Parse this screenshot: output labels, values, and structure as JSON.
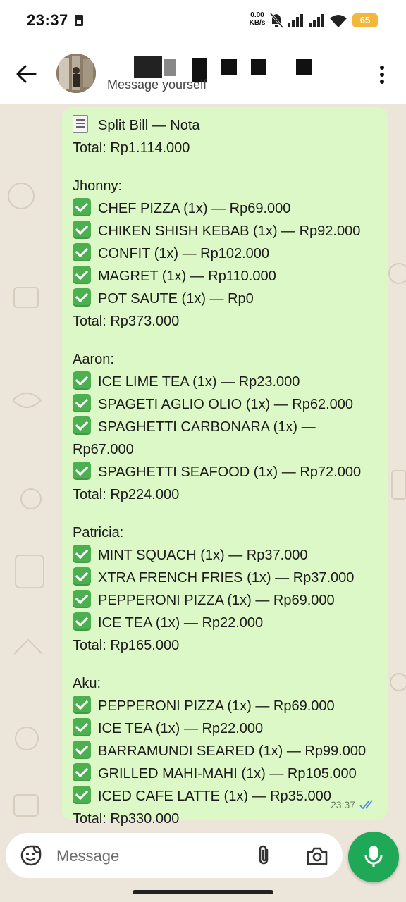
{
  "status_bar": {
    "time": "23:37",
    "net_speed_value": "0.00",
    "net_speed_unit": "KB/s",
    "battery": "65"
  },
  "header": {
    "subtitle": "Message yourself"
  },
  "message": {
    "lines": [
      {
        "type": "title",
        "text": "Split Bill — Nota"
      },
      {
        "type": "text",
        "text": "Total: Rp1.114.000"
      },
      {
        "type": "gap"
      },
      {
        "type": "text",
        "text": "Jhonny:"
      },
      {
        "type": "item",
        "text": "CHEF PIZZA (1x) — Rp69.000"
      },
      {
        "type": "item",
        "text": "CHIKEN SHISH KEBAB (1x) — Rp92.000"
      },
      {
        "type": "item",
        "text": "CONFIT (1x) — Rp102.000"
      },
      {
        "type": "item",
        "text": "MAGRET (1x) — Rp110.000"
      },
      {
        "type": "item",
        "text": "POT SAUTE (1x) — Rp0"
      },
      {
        "type": "text",
        "text": "Total: Rp373.000"
      },
      {
        "type": "gap"
      },
      {
        "type": "text",
        "text": "Aaron:"
      },
      {
        "type": "item",
        "text": "ICE LIME TEA (1x) — Rp23.000"
      },
      {
        "type": "item",
        "text": "SPAGETI AGLIO OLIO (1x) — Rp62.000"
      },
      {
        "type": "item",
        "text": "SPAGHETTI CARBONARA (1x) —"
      },
      {
        "type": "text",
        "text": "Rp67.000"
      },
      {
        "type": "item",
        "text": "SPAGHETTI SEAFOOD (1x) — Rp72.000"
      },
      {
        "type": "text",
        "text": "Total: Rp224.000"
      },
      {
        "type": "gap"
      },
      {
        "type": "text",
        "text": "Patricia:"
      },
      {
        "type": "item",
        "text": "MINT SQUACH (1x) — Rp37.000"
      },
      {
        "type": "item",
        "text": "XTRA FRENCH FRIES (1x) — Rp37.000"
      },
      {
        "type": "item",
        "text": "PEPPERONI PIZZA (1x) — Rp69.000"
      },
      {
        "type": "item",
        "text": "ICE TEA (1x) — Rp22.000"
      },
      {
        "type": "text",
        "text": "Total: Rp165.000"
      },
      {
        "type": "gap"
      },
      {
        "type": "text",
        "text": "Aku:"
      },
      {
        "type": "item",
        "text": "PEPPERONI PIZZA (1x) — Rp69.000"
      },
      {
        "type": "item",
        "text": "ICE TEA (1x) — Rp22.000"
      },
      {
        "type": "item",
        "text": "BARRAMUNDI SEARED (1x) — Rp99.000"
      },
      {
        "type": "item",
        "text": "GRILLED MAHI-MAHI (1x) — Rp105.000"
      },
      {
        "type": "item",
        "text": "ICED CAFE LATTE (1x) — Rp35.000"
      },
      {
        "type": "text",
        "text": "Total: Rp330.000"
      }
    ],
    "time": "23:37",
    "status_icon": "double-check-read-icon"
  },
  "input_bar": {
    "placeholder": "Message"
  },
  "colors": {
    "bubble": "#dcf8c6",
    "chat_background": "#ece5da",
    "accent": "#1fa855",
    "read_ticks": "#4a90e2"
  }
}
